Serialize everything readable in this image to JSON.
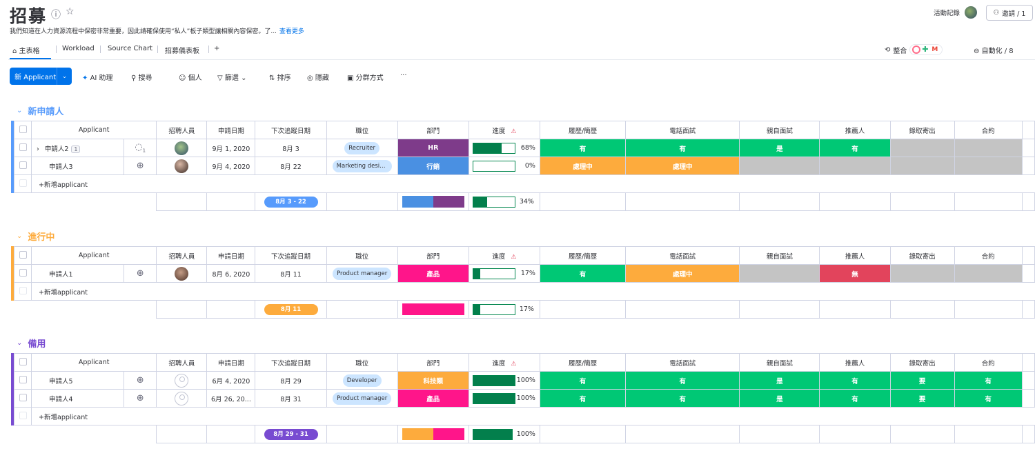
{
  "header": {
    "title": "招募",
    "description": "我們知道在人力資源流程中保密非常重要，因此請確保使用“私人”板子類型讓相關內容保密。了...",
    "see_more": "查看更多",
    "activity_log": "活動記錄",
    "invite": "邀請 / 1",
    "info_icon": "info-icon",
    "star_icon": "star-icon"
  },
  "tabs": [
    {
      "label": "主表格",
      "icon": "home-icon"
    },
    {
      "label": "Workload"
    },
    {
      "label": "Source Chart"
    },
    {
      "label": "招募儀表板"
    },
    {
      "label": "+"
    }
  ],
  "right_tools": {
    "integrate": "整合",
    "automate": "自動化 / 8"
  },
  "toolbar": {
    "new_item": "新 Applicant",
    "ai": "AI 助理",
    "search": "搜尋",
    "person": "個人",
    "filter": "篩選",
    "sort": "排序",
    "hide": "隱藏",
    "group_by": "分群方式",
    "more": "···"
  },
  "columns": [
    "Applicant",
    "招聘人員",
    "申請日期",
    "下次追蹤日期",
    "職位",
    "部門",
    "進度",
    "履歷/簡歷",
    "電話面試",
    "親自面試",
    "推薦人",
    "錄取寄出",
    "合約"
  ],
  "add_row_label": "+新增applicant",
  "colors": {
    "green": "#00c875",
    "orange": "#fdab3d",
    "gray": "#c4c4c4",
    "red": "#e2445c",
    "pink": "#ff158a",
    "purple": "#784bd1",
    "blue": "#579bfc",
    "hr": "#7e3b8a",
    "dept_blue": "#4a90e2"
  },
  "groups": [
    {
      "title": "新申請人",
      "color": "#579bfc",
      "rows": [
        {
          "name": "申請人2",
          "count": "1",
          "expand": true,
          "update_icon": "chat-icon-count",
          "recruiter": "photo",
          "applied": "9月 1, 2020",
          "next": "8月 3",
          "position": "Recruiter",
          "dept": "HR",
          "dept_color": "#7e3b8a",
          "progress": 68,
          "progress_label": "68%",
          "resume": {
            "t": "有",
            "c": "#00c875"
          },
          "phone": {
            "t": "有",
            "c": "#00c875"
          },
          "inperson": {
            "t": "是",
            "c": "#00c875"
          },
          "referrer": {
            "t": "有",
            "c": "#00c875"
          },
          "offer": {
            "t": "",
            "c": "#c4c4c4"
          },
          "contract": {
            "t": "",
            "c": "#c4c4c4"
          }
        },
        {
          "name": "申請人3",
          "update_icon": "add-update-icon",
          "recruiter": "photo2",
          "applied": "9月 4, 2020",
          "next": "8月 22",
          "position": "Marketing design...",
          "dept": "行銷",
          "dept_color": "#4a90e2",
          "progress": 0,
          "progress_label": "0%",
          "resume": {
            "t": "處理中",
            "c": "#fdab3d"
          },
          "phone": {
            "t": "處理中",
            "c": "#fdab3d"
          },
          "inperson": {
            "t": "",
            "c": "#c4c4c4"
          },
          "referrer": {
            "t": "",
            "c": "#c4c4c4"
          },
          "offer": {
            "t": "",
            "c": "#c4c4c4"
          },
          "contract": {
            "t": "",
            "c": "#c4c4c4"
          }
        }
      ],
      "summary": {
        "date_range": "8月 3 - 22",
        "dept_bar": [
          {
            "c": "#4a90e2",
            "w": 0.5
          },
          {
            "c": "#7e3b8a",
            "w": 0.5
          }
        ],
        "progress": 34,
        "progress_label": "34%"
      }
    },
    {
      "title": "進行中",
      "color": "#fdab3d",
      "rows": [
        {
          "name": "申請人1",
          "update_icon": "add-update-icon",
          "recruiter": "photo3",
          "applied": "8月 6, 2020",
          "next": "8月 11",
          "position": "Product manager",
          "dept": "產品",
          "dept_color": "#ff158a",
          "progress": 17,
          "progress_label": "17%",
          "resume": {
            "t": "有",
            "c": "#00c875"
          },
          "phone": {
            "t": "處理中",
            "c": "#fdab3d"
          },
          "inperson": {
            "t": "",
            "c": "#c4c4c4"
          },
          "referrer": {
            "t": "無",
            "c": "#e2445c"
          },
          "offer": {
            "t": "",
            "c": "#c4c4c4"
          },
          "contract": {
            "t": "",
            "c": "#c4c4c4"
          }
        }
      ],
      "summary": {
        "date_range": "8月 11",
        "dept_bar": [
          {
            "c": "#ff158a",
            "w": 1
          }
        ],
        "progress": 17,
        "progress_label": "17%"
      }
    },
    {
      "title": "備用",
      "color": "#784bd1",
      "rows": [
        {
          "name": "申請人5",
          "update_icon": "add-update-icon",
          "recruiter": "empty",
          "applied": "6月 4, 2020",
          "next": "8月 29",
          "position": "Developer",
          "dept": "科技類",
          "dept_color": "#fdab3d",
          "progress": 100,
          "progress_label": "100%",
          "resume": {
            "t": "有",
            "c": "#00c875"
          },
          "phone": {
            "t": "有",
            "c": "#00c875"
          },
          "inperson": {
            "t": "是",
            "c": "#00c875"
          },
          "referrer": {
            "t": "有",
            "c": "#00c875"
          },
          "offer": {
            "t": "要",
            "c": "#00c875"
          },
          "contract": {
            "t": "有",
            "c": "#00c875"
          }
        },
        {
          "name": "申請人4",
          "update_icon": "add-update-icon",
          "recruiter": "empty",
          "applied": "6月 26, 20...",
          "next": "8月 31",
          "position": "Product manager",
          "dept": "產品",
          "dept_color": "#ff158a",
          "progress": 100,
          "progress_label": "100%",
          "resume": {
            "t": "有",
            "c": "#00c875"
          },
          "phone": {
            "t": "有",
            "c": "#00c875"
          },
          "inperson": {
            "t": "是",
            "c": "#00c875"
          },
          "referrer": {
            "t": "有",
            "c": "#00c875"
          },
          "offer": {
            "t": "要",
            "c": "#00c875"
          },
          "contract": {
            "t": "有",
            "c": "#00c875"
          }
        }
      ],
      "summary": {
        "date_range": "8月 29 - 31",
        "dept_bar": [
          {
            "c": "#fdab3d",
            "w": 0.5
          },
          {
            "c": "#ff158a",
            "w": 0.5
          }
        ],
        "progress": 100,
        "progress_label": "100%"
      }
    }
  ]
}
